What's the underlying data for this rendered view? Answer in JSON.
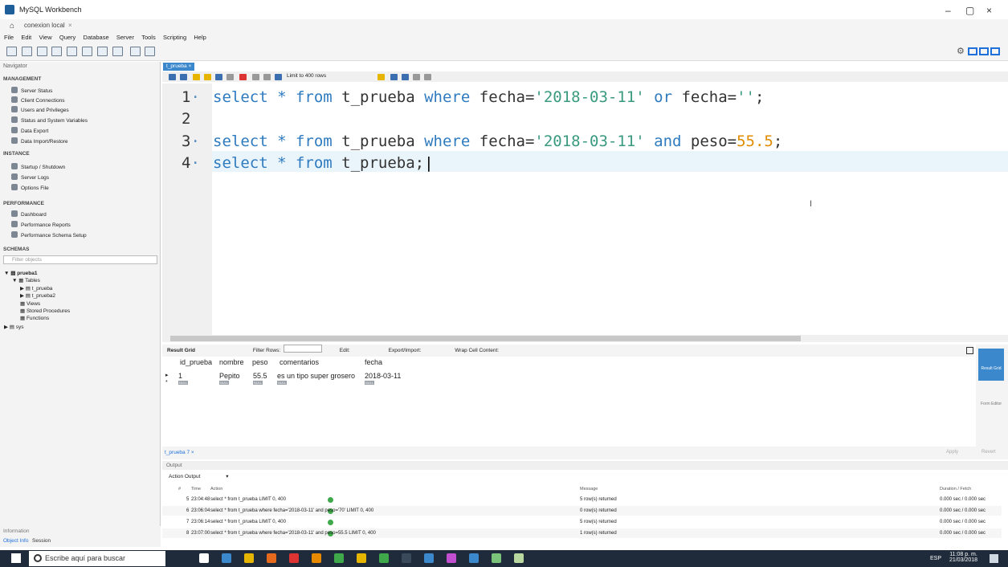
{
  "window": {
    "title": "MySQL Workbench",
    "tab": "conexion local",
    "close": "×",
    "min": "–",
    "max": "▢",
    "x": "×"
  },
  "menu": [
    "File",
    "Edit",
    "View",
    "Query",
    "Database",
    "Server",
    "Tools",
    "Scripting",
    "Help"
  ],
  "navigator": {
    "title": "Navigator",
    "management": {
      "label": "MANAGEMENT",
      "items": [
        "Server Status",
        "Client Connections",
        "Users and Privileges",
        "Status and System Variables",
        "Data Export",
        "Data Import/Restore"
      ]
    },
    "instance": {
      "label": "INSTANCE",
      "items": [
        "Startup / Shutdown",
        "Server Logs",
        "Options File"
      ]
    },
    "performance": {
      "label": "PERFORMANCE",
      "items": [
        "Dashboard",
        "Performance Reports",
        "Performance Schema Setup"
      ]
    },
    "schemas": {
      "label": "SCHEMAS",
      "filter_placeholder": "Filter objects"
    },
    "tree": {
      "db": "prueba1",
      "tables": "Tables",
      "t1": "t_prueba",
      "t2": "t_prueba2",
      "views": "Views",
      "procs": "Stored Procedures",
      "funcs": "Functions",
      "sys": "sys"
    }
  },
  "info": {
    "label": "Information",
    "tab1": "Object Info",
    "tab2": "Session"
  },
  "editor": {
    "tab": "t_prueba",
    "limit": "Limit to 400 rows",
    "lines": {
      "l1": {
        "num": "1",
        "a": "select * ",
        "b": "from",
        "c": " t_prueba ",
        "d": "where",
        "e": " fecha=",
        "f": "'2018-03-11'",
        "g": " ",
        "h": "or",
        "i": " fecha=",
        "j": "''",
        "k": ";"
      },
      "l2": {
        "num": "2"
      },
      "l3": {
        "num": "3",
        "a": "select * ",
        "b": "from",
        "c": " t_prueba ",
        "d": "where",
        "e": " fecha=",
        "f": "'2018-03-11'",
        "g": " ",
        "h": "and",
        "i": " peso=",
        "j": "55.5",
        "k": ";"
      },
      "l4": {
        "num": "4",
        "a": "select * ",
        "b": "from",
        "c": " t_prueba;"
      }
    }
  },
  "result": {
    "toolbar": {
      "grid": "Result Grid",
      "filter": "Filter Rows:",
      "edit": "Edit:",
      "export": "Export/Import:",
      "wrap": "Wrap Cell Content:"
    },
    "columns": [
      "id_prueba",
      "nombre",
      "peso",
      "comentarios",
      "fecha"
    ],
    "row": [
      "1",
      "Pepito",
      "55.5",
      "es un tipo super grosero",
      "2018-03-11"
    ],
    "null": "NULL",
    "side": {
      "grid": "Result Grid",
      "form": "Form Editor"
    },
    "footer": {
      "tab": "t_prueba 7",
      "apply": "Apply",
      "revert": "Revert"
    }
  },
  "output": {
    "label": "Output",
    "selector": "Action Output",
    "headers": {
      "num": "#",
      "time": "Time",
      "action": "Action",
      "message": "Message",
      "duration": "Duration / Fetch"
    },
    "rows": [
      {
        "num": "5",
        "time": "23:04:48",
        "action": "select * from t_prueba LIMIT 0, 400",
        "message": "5 row(s) returned",
        "duration": "0.000 sec / 0.000 sec"
      },
      {
        "num": "6",
        "time": "23:06:04",
        "action": "select * from t_prueba where fecha='2018-03-11' and peso='70' LIMIT 0, 400",
        "message": "0 row(s) returned",
        "duration": "0.000 sec / 0.000 sec"
      },
      {
        "num": "7",
        "time": "23:06:14",
        "action": "select * from t_prueba LIMIT 0, 400",
        "message": "5 row(s) returned",
        "duration": "0.000 sec / 0.000 sec"
      },
      {
        "num": "8",
        "time": "23:07:00",
        "action": "select * from t_prueba where fecha='2018-03-11' and peso=55.5 LIMIT 0, 400",
        "message": "1 row(s) returned",
        "duration": "0.000 sec / 0.000 sec"
      }
    ]
  },
  "taskbar": {
    "search": "Escribe aquí para buscar",
    "lang": "ESP",
    "time": "11:08 p. m.",
    "date": "21/03/2018"
  }
}
